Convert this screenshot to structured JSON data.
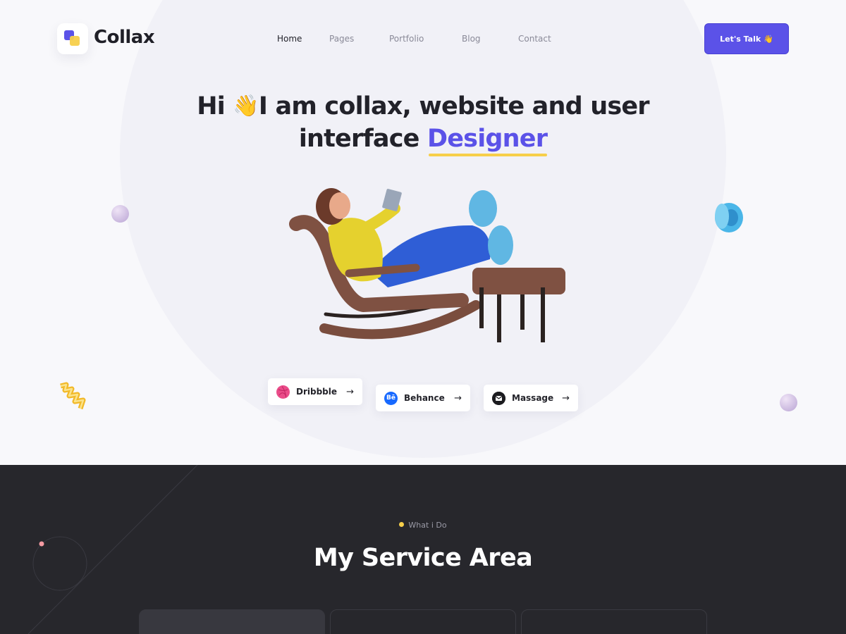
{
  "brand": {
    "name": "Collax"
  },
  "nav": {
    "items": [
      {
        "label": "Home",
        "active": true
      },
      {
        "label": "Pages",
        "active": false
      },
      {
        "label": "Portfolio",
        "active": false
      },
      {
        "label": "Blog",
        "active": false
      },
      {
        "label": "Contact",
        "active": false
      }
    ]
  },
  "cta": {
    "label": "Let's Talk",
    "emoji": "👋"
  },
  "hero": {
    "line1_pre": "Hi",
    "wave_emoji": "👋",
    "line1_post": "I am collax, website and user",
    "line2_pre": "interface",
    "line2_accent": "Designer"
  },
  "social": [
    {
      "label": "Dribbble",
      "icon": "dribbble-icon",
      "arrow": "→"
    },
    {
      "label": "Behance",
      "icon": "behance-icon",
      "icon_text": "Bē",
      "arrow": "→"
    },
    {
      "label": "Massage",
      "icon": "gmail-icon",
      "arrow": "→"
    }
  ],
  "services": {
    "eyebrow": "What i Do",
    "title": "My Service Area"
  },
  "colors": {
    "accent": "#5b52e8",
    "highlight": "#f7cf4a",
    "dark_bg": "#27272c",
    "dribbble": "#ea4c89",
    "behance": "#1769ff"
  }
}
